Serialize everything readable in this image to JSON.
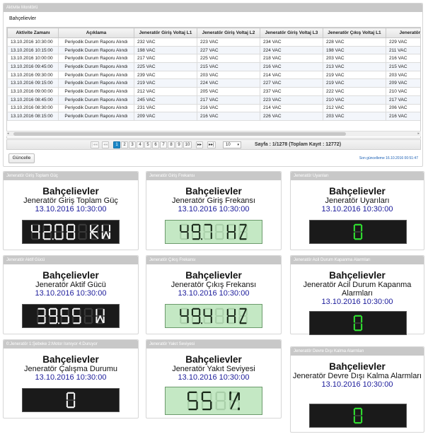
{
  "monitor": {
    "title": "Aktivite Monitörü",
    "subtitle": "Bahçelievler",
    "columns": [
      "Aktivite Zamanı",
      "Açıklama",
      "Jeneratör Giriş Voltaj L1",
      "Jeneratör Giriş Voltaj L2",
      "Jeneratör Giriş Voltaj L3",
      "Jeneratör Çıkış Voltaj L1",
      "Jeneratör Çıkış"
    ],
    "rows": [
      [
        "13.10.2016 10:30:00",
        "Periyodik Durum Raporu Alındı",
        "232 VAC",
        "223 VAC",
        "234 VAC",
        "228 VAC",
        "229 VAC"
      ],
      [
        "13.10.2016 10:15:00",
        "Periyodik Durum Raporu Alındı",
        "198 VAC",
        "227 VAC",
        "224 VAC",
        "198 VAC",
        "211 VAC"
      ],
      [
        "13.10.2016 10:00:00",
        "Periyodik Durum Raporu Alındı",
        "217 VAC",
        "225 VAC",
        "218 VAC",
        "203 VAC",
        "216 VAC"
      ],
      [
        "13.10.2016 09:45:00",
        "Periyodik Durum Raporu Alındı",
        "225 VAC",
        "215 VAC",
        "216 VAC",
        "213 VAC",
        "215 VAC"
      ],
      [
        "13.10.2016 09:30:00",
        "Periyodik Durum Raporu Alındı",
        "239 VAC",
        "203 VAC",
        "214 VAC",
        "219 VAC",
        "203 VAC"
      ],
      [
        "13.10.2016 09:15:00",
        "Periyodik Durum Raporu Alındı",
        "219 VAC",
        "224 VAC",
        "227 VAC",
        "219 VAC",
        "209 VAC"
      ],
      [
        "13.10.2016 09:00:00",
        "Periyodik Durum Raporu Alındı",
        "212 VAC",
        "205 VAC",
        "237 VAC",
        "222 VAC",
        "210 VAC"
      ],
      [
        "13.10.2016 08:45:00",
        "Periyodik Durum Raporu Alındı",
        "245 VAC",
        "217 VAC",
        "223 VAC",
        "210 VAC",
        "217 VAC"
      ],
      [
        "13.10.2016 08:30:00",
        "Periyodik Durum Raporu Alındı",
        "231 VAC",
        "216 VAC",
        "214 VAC",
        "212 VAC",
        "206 VAC"
      ],
      [
        "13.10.2016 08:15:00",
        "Periyodik Durum Raporu Alındı",
        "209 VAC",
        "216 VAC",
        "226 VAC",
        "203 VAC",
        "216 VAC"
      ]
    ],
    "pager": {
      "first": "|◂◂",
      "prev": "◂◂",
      "pages": [
        "1",
        "2",
        "3",
        "4",
        "5",
        "6",
        "7",
        "8",
        "9",
        "10"
      ],
      "next": "▸▸",
      "last": "▸▸|",
      "page_size": "10",
      "info": "Sayfa : 1/1278 (Toplam Kayıt : 12772)"
    },
    "refresh_label": "Güncelle",
    "last_update": "Son güncelleme 16.10.2016 00:51:47"
  },
  "cards": [
    {
      "header": "Jeneratör Giriş Toplam Güç",
      "location": "Bahçelievler",
      "title": "Jeneratör Giriş Toplam Güç",
      "datetime": "13.10.2016 10:30:00",
      "display": "42.08 KW",
      "theme": "dark",
      "color": "#f2f2f2"
    },
    {
      "header": "Jeneratör Giriş Frekansı",
      "location": "Bahçelievler",
      "title": "Jeneratör Giriş Frekansı",
      "datetime": "13.10.2016 10:30:00",
      "display": "49.7 HZ",
      "theme": "light",
      "color": "#1a2a1a"
    },
    {
      "header": "Jeneratör Uyarıları",
      "location": "Bahçelievler",
      "title": "Jeneratör Uyarıları",
      "datetime": "13.10.2016 10:30:00",
      "display": "0",
      "theme": "dark",
      "color": "#2fe02f"
    },
    {
      "header": "Jeneratör Aktif Gücü",
      "location": "Bahçelievler",
      "title": "Jeneratör Aktif Gücü",
      "datetime": "13.10.2016 10:30:00",
      "display": "39.55 W",
      "theme": "dark",
      "color": "#f2f2f2"
    },
    {
      "header": "Jeneratör Çıkış Frekansı",
      "location": "Bahçelievler",
      "title": "Jeneratör Çıkış Frekansı",
      "datetime": "13.10.2016 10:30:00",
      "display": "49.4 HZ",
      "theme": "light",
      "color": "#1a2a1a"
    },
    {
      "header": "Jeneratör Acil Durum Kapanma Alarmları",
      "location": "Bahçelievler",
      "title": "Jeneratör Acil Durum Kapanma Alarmları",
      "datetime": "13.10.2016 10:30:00",
      "display": "0",
      "theme": "dark",
      "color": "#2fe02f"
    },
    {
      "header": "0:Jeneratör 1:Şebeke 2:Motor Isınıyor 4:Duruyor",
      "location": "Bahçelievler",
      "title": "Jeneratör Çalışma Durumu",
      "datetime": "13.10.2016 10:30:00",
      "display": "0",
      "theme": "dark",
      "color": "#f2f2f2"
    },
    {
      "header": "Jeneratör Yakıt Seviyesi",
      "location": "Bahçelievler",
      "title": "Jeneratör Yakıt Seviyesi",
      "datetime": "13.10.2016 10:30:00",
      "display": "55 %",
      "theme": "light",
      "color": "#1a2a1a"
    },
    {
      "header": "Jeneratör Devre Dışı Kalma Alarmları",
      "location": "Bahçelievler",
      "title": "Jeneratör Devre Dışı Kalma Alarmları",
      "datetime": "13.10.2016 10:30:00",
      "display": "0",
      "theme": "dark",
      "color": "#2fe02f"
    }
  ]
}
